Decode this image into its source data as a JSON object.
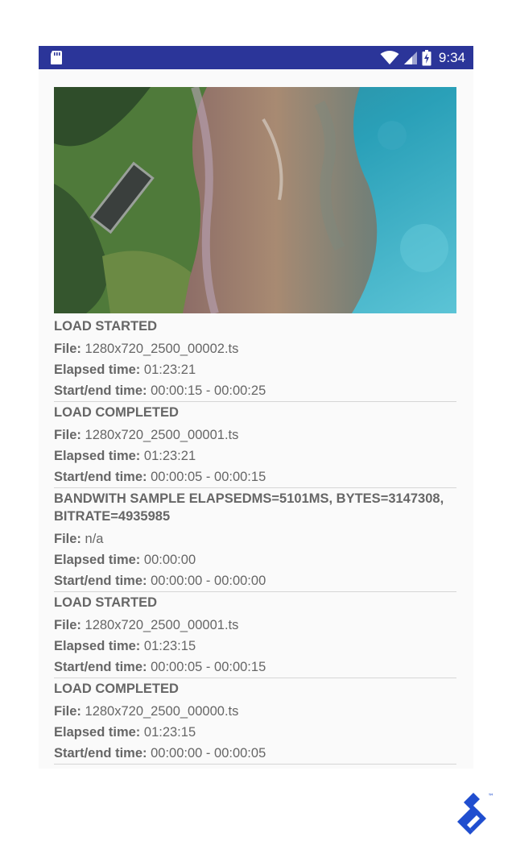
{
  "status_bar": {
    "time": "9:34",
    "icons": [
      "sd-card-icon",
      "wifi-icon",
      "cell-signal-icon",
      "battery-charging-icon"
    ],
    "color": "#2b3599"
  },
  "video": {
    "description_icon": "video-player"
  },
  "labels": {
    "file": "File:",
    "elapsed": "Elapsed time:",
    "start_end": "Start/end time:"
  },
  "events": [
    {
      "title": "LOAD STARTED",
      "file": "1280x720_2500_00002.ts",
      "elapsed": "01:23:21",
      "start_end": "00:00:15 - 00:00:25"
    },
    {
      "title": "LOAD COMPLETED",
      "file": "1280x720_2500_00001.ts",
      "elapsed": "01:23:21",
      "start_end": "00:00:05 - 00:00:15"
    },
    {
      "title": "BANDWITH SAMPLE ELAPSEDMS=5101MS, BYTES=3147308, BITRATE=4935985",
      "file": "n/a",
      "elapsed": "00:00:00",
      "start_end": "00:00:00 - 00:00:00"
    },
    {
      "title": "LOAD STARTED",
      "file": "1280x720_2500_00001.ts",
      "elapsed": "01:23:15",
      "start_end": "00:00:05 - 00:00:15"
    },
    {
      "title": "LOAD COMPLETED",
      "file": "1280x720_2500_00000.ts",
      "elapsed": "01:23:15",
      "start_end": "00:00:00 - 00:00:05"
    }
  ],
  "watermark": {
    "brand": "toptal-logo",
    "tm": "™",
    "color": "#204ecf"
  }
}
